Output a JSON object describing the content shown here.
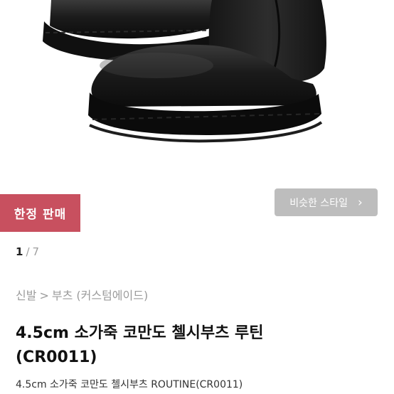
{
  "badge": {
    "label": "한정 판매",
    "color": "#c8505f"
  },
  "similar_style": {
    "label": "비슷한 스타일",
    "icon": "chevron-right-icon"
  },
  "pager": {
    "current": "1",
    "separator": "/",
    "total": "7"
  },
  "breadcrumb": {
    "category": "신발",
    "arrow": ">",
    "subcategory": "부츠 (커스텀에이드)"
  },
  "product": {
    "title_line1": "4.5cm 소가죽 코만도 첼시부츠 루틴",
    "title_line2": "(CR0011)",
    "subtitle": "4.5cm 소가죽 코만도 첼시부츠 ROUTINE(CR0011)"
  }
}
